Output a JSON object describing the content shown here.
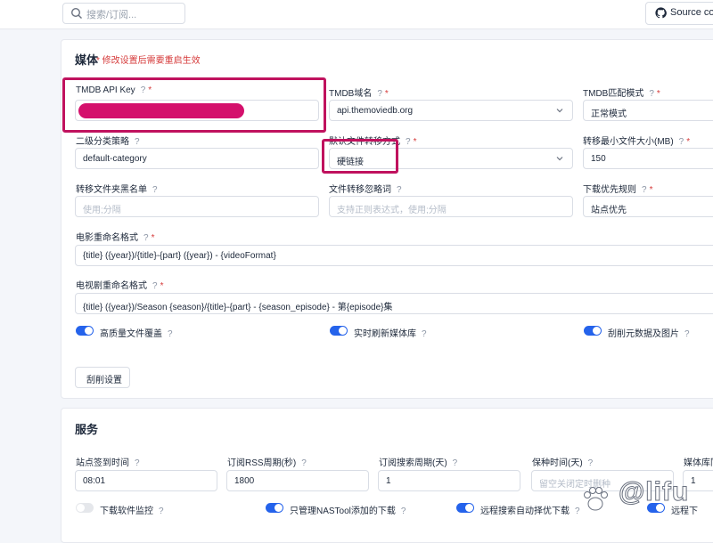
{
  "topbar": {
    "search_placeholder": "搜索/订阅...",
    "source_label": "Source cod"
  },
  "media": {
    "title": "媒体",
    "hint": "* 修改设置后需要重启生效",
    "tmdb_key_label": "TMDB API Key",
    "tmdb_domain_label": "TMDB域名",
    "tmdb_domain_value": "api.themoviedb.org",
    "tmdb_match_label": "TMDB匹配模式",
    "tmdb_match_value": "正常模式",
    "secondary_label": "二级分类策略",
    "secondary_value": "default-category",
    "transfer_mode_label": "默认文件转移方式",
    "transfer_mode_value": "硬链接",
    "min_size_label": "转移最小文件大小(MB)",
    "min_size_value": "150",
    "blacklist_label": "转移文件夹黑名单",
    "blacklist_placeholder": "使用;分隔",
    "ignore_label": "文件转移忽略词",
    "ignore_placeholder": "支持正则表达式，使用;分隔",
    "priority_label": "下载优先规则",
    "priority_value": "站点优先",
    "movie_rename_label": "电影重命名格式",
    "movie_rename_value": "{title} ({year})/{title}-{part} ({year}) - {videoFormat}",
    "tv_rename_label": "电视剧重命名格式",
    "tv_rename_value": "{title} ({year})/Season {season}/{title}-{part} - {season_episode} - 第{episode}集",
    "toggle1_label": "高质量文件覆盖",
    "toggle2_label": "实时刷新媒体库",
    "toggle3_label": "刮削元数据及图片",
    "scrape_button": "刮削设置"
  },
  "service": {
    "title": "服务",
    "signin_label": "站点签到时间",
    "signin_value": "08:01",
    "rss_label": "订阅RSS周期(秒)",
    "rss_value": "1800",
    "search_period_label": "订阅搜索周期(天)",
    "search_period_value": "1",
    "keep_label": "保种时间(天)",
    "keep_placeholder": "留空关闭定时删种",
    "media_lib_label": "媒体库同",
    "media_lib_value": "1",
    "toggle1_label": "下载软件监控",
    "toggle2_label": "只管理NASTool添加的下载",
    "toggle3_label": "远程搜索自动择优下载",
    "toggle4_label": "远程下"
  },
  "watermark": "@lifu"
}
